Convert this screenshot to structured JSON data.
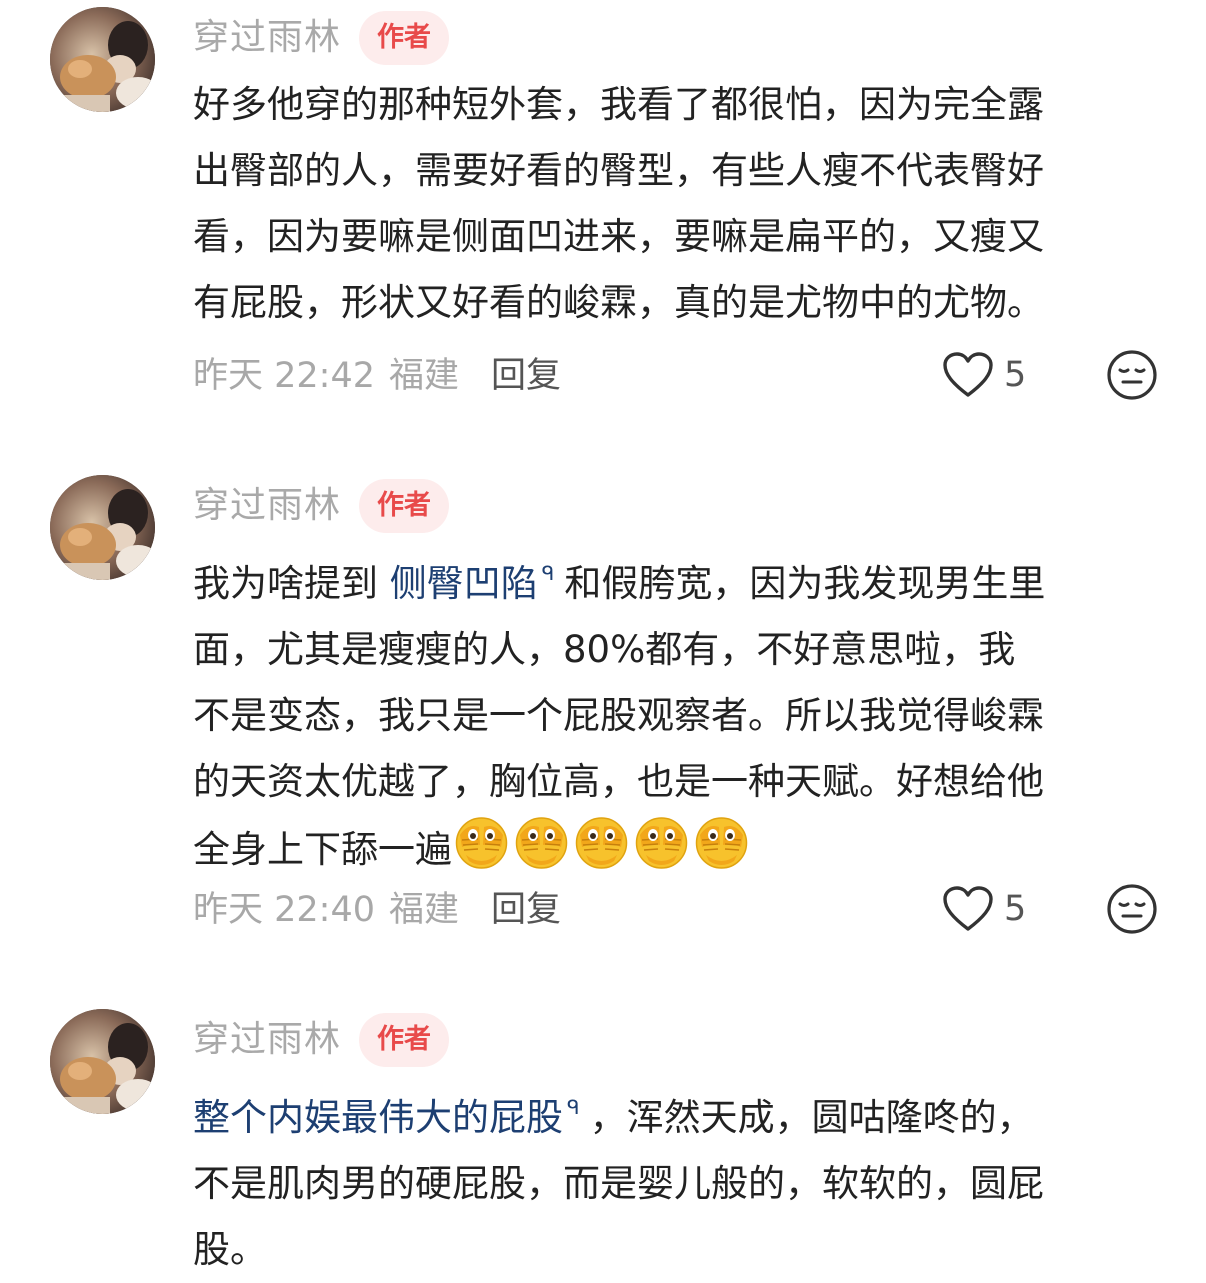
{
  "comments": [
    {
      "username": "穿过雨林",
      "badge": "作者",
      "lines": [
        "好多他穿的那种短外套，我看了都很怕，因为完全露",
        "出臀部的人，需要好看的臀型，有些人瘦不代表臀好",
        "看，因为要嘛是侧面凹进来，要嘛是扁平的，又瘦又",
        "有屁股，形状又好看的峻霖，真的是尤物中的尤物。"
      ],
      "time": "昨天 22:42",
      "location": "福建",
      "reply_label": "回复",
      "likes": "5"
    },
    {
      "username": "穿过雨林",
      "badge": "作者",
      "line1_before": "我为啥提到",
      "line1_topic": "侧臀凹陷",
      "line1_after": "和假胯宽，因为我发现男生里",
      "lines": [
        "面，尤其是瘦瘦的人，80%都有，不好意思啦，我",
        "不是变态，我只是一个屁股观察者。所以我觉得峻霖",
        "的天资太优越了，胸位高，也是一种天赋。好想给他"
      ],
      "last_line": "全身上下舔一遍",
      "emoji_name": "face-with-open-eyes-and-hand-over-mouth",
      "emoji_count": 5,
      "time": "昨天 22:40",
      "location": "福建",
      "reply_label": "回复",
      "likes": "5"
    },
    {
      "username": "穿过雨林",
      "badge": "作者",
      "line1_topic": "整个内娱最伟大的屁股",
      "line1_after": "，浑然天成，圆咕隆咚的，",
      "lines": [
        "不是肌肉男的硬屁股，而是婴儿般的，软软的，圆屁",
        "股。"
      ]
    }
  ],
  "topic_search_glyph": "ᑫ",
  "colors": {
    "username": "#a9a9a9",
    "badge_bg": "#fdecec",
    "badge_text": "#e84a4a",
    "topic_link": "#1d3f72",
    "body_text": "#222222",
    "meta_text": "#a8a8a8"
  },
  "icons": {
    "like": "heart-outline-icon",
    "expression": "expressionless-face-icon"
  }
}
